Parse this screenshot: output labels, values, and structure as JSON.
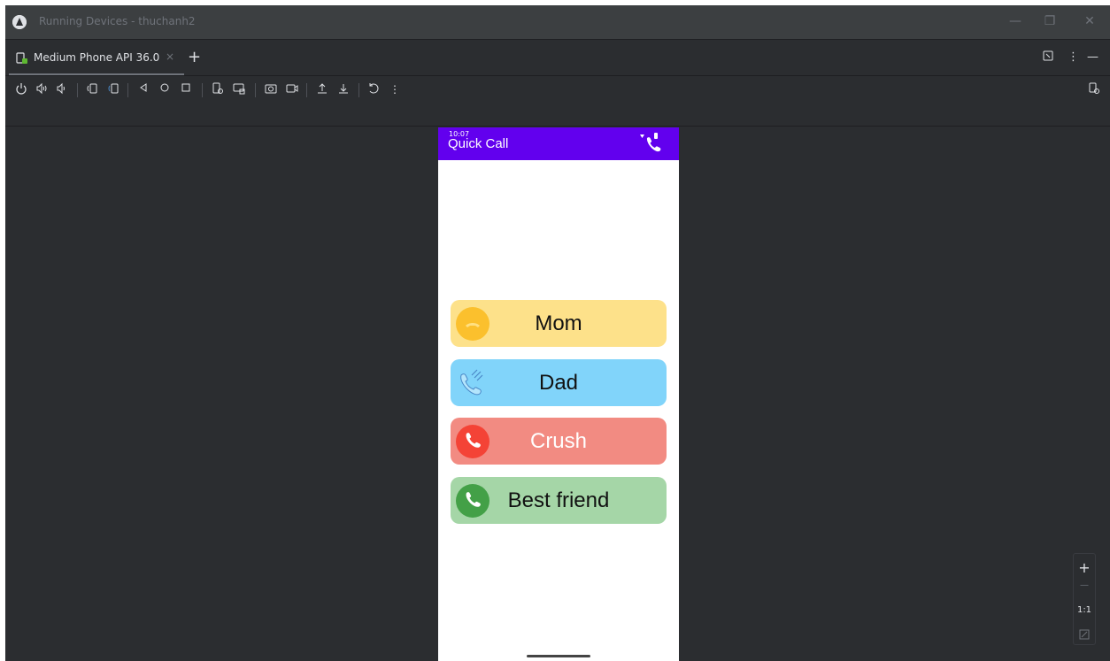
{
  "window": {
    "title": "Running Devices - thuchanh2",
    "controls": {
      "minimize": "—",
      "restore": "❐",
      "close": "✕"
    }
  },
  "tabbar": {
    "tab_label": "Medium Phone API 36.0",
    "tab_close": "×",
    "add_tab": "+",
    "more": "⋮",
    "hide": "—"
  },
  "toolbar": {
    "icons": [
      "power-icon",
      "volume-up-icon",
      "volume-down-icon",
      "rotate-left-icon",
      "rotate-right-icon",
      "back-icon",
      "home-icon",
      "overview-icon",
      "device-screenshot-icon",
      "device-frame-icon",
      "camera-icon",
      "record-icon",
      "upload-icon",
      "download-icon",
      "reset-icon",
      "more-icon"
    ]
  },
  "phone": {
    "status_time": "10:07",
    "app_title": "Quick Call",
    "appbar_color": "#6200ee",
    "contacts": [
      {
        "name": "Mom",
        "bg": "#fde18a",
        "icon_bg": "#fbc02d",
        "icon": "phone-hangup-icon",
        "text_color": "#111111"
      },
      {
        "name": "Dad",
        "bg": "#81d4fa",
        "icon_bg": "#81d4fa",
        "icon": "phone-ringing-icon",
        "text_color": "#111111"
      },
      {
        "name": "Crush",
        "bg": "#f28b82",
        "icon_bg": "#f44336",
        "icon": "phone-icon",
        "text_color": "#ffffff"
      },
      {
        "name": "Best friend",
        "bg": "#a5d6a7",
        "icon_bg": "#43a047",
        "icon": "phone-icon",
        "text_color": "#111111"
      }
    ]
  },
  "zoom": {
    "plus": "+",
    "minus": "—",
    "one_to_one": "1:1"
  }
}
